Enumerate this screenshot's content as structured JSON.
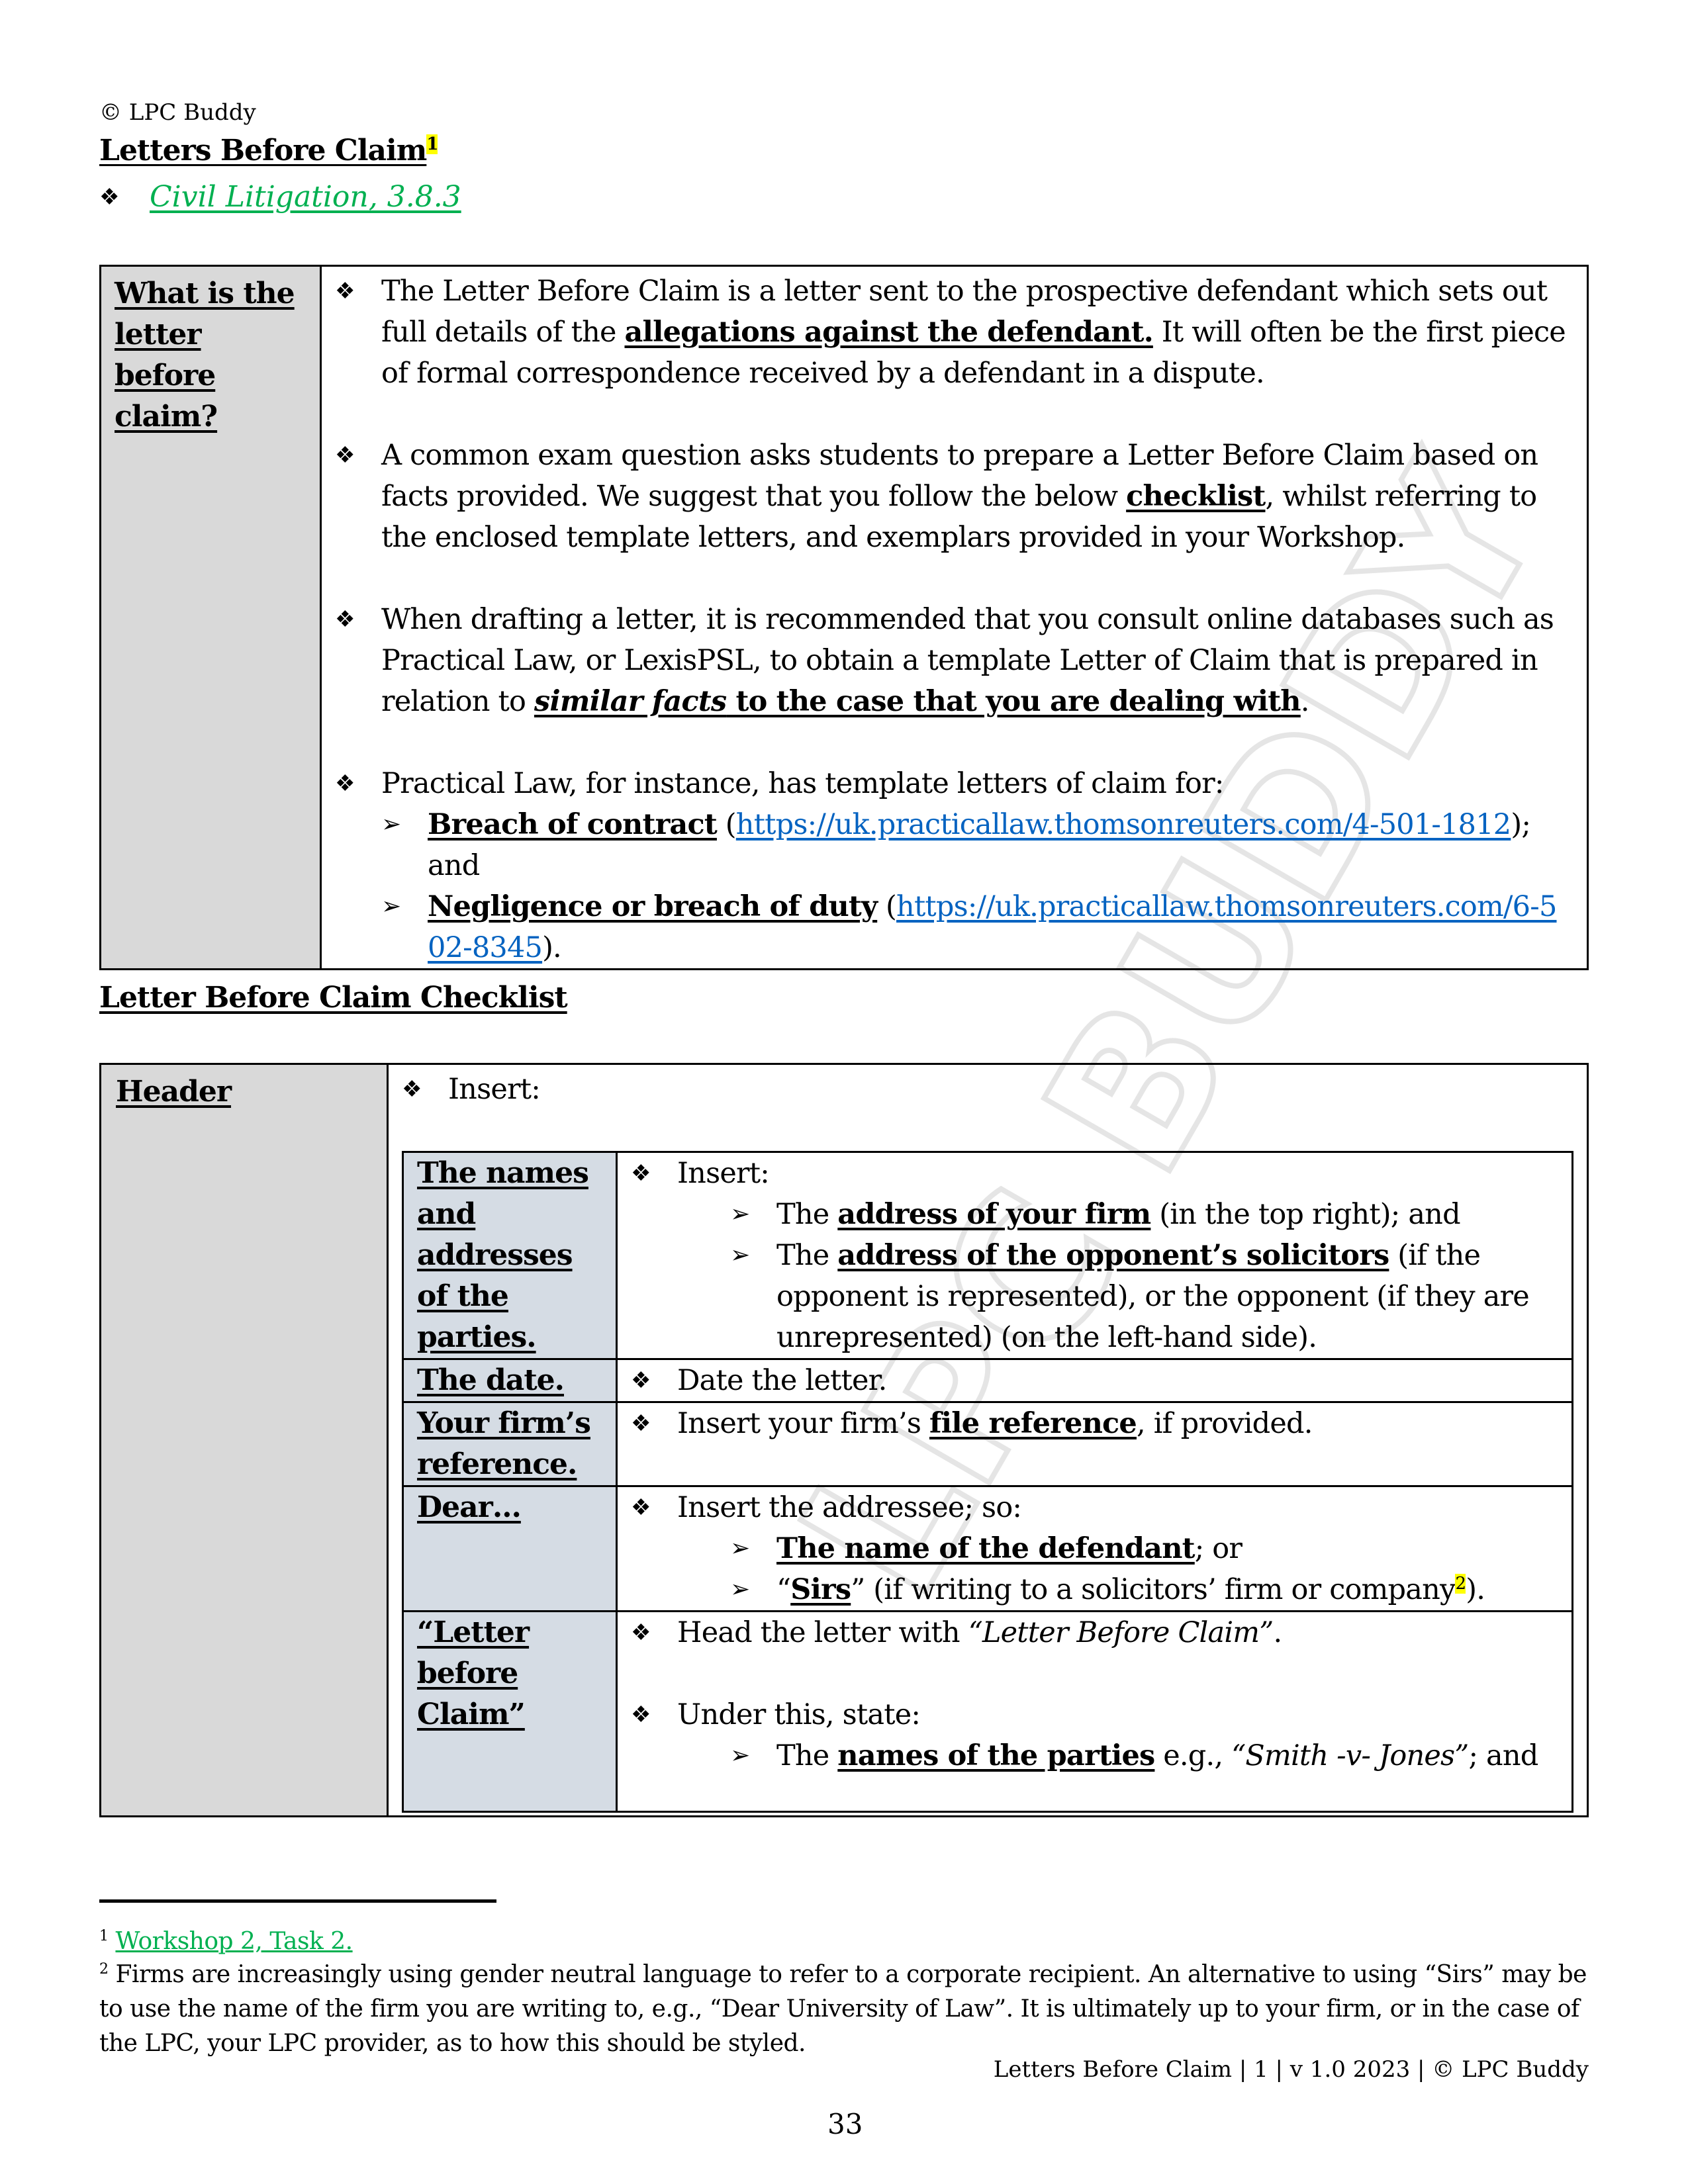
{
  "header": {
    "copyright": "© LPC Buddy",
    "title": "Letters Before Claim",
    "title_footnote_ref": "1",
    "reference_link": "Civil Litigation, 3.8.3"
  },
  "intro_table": {
    "label": "What is the letter before claim?",
    "bullets": [
      {
        "parts": [
          "The Letter Before Claim is a letter sent to the prospective defendant which sets out full details of the ",
          "allegations against the defendant.",
          " It will often be the first piece of formal correspondence received by a defendant in a dispute."
        ]
      },
      {
        "parts": [
          "A common exam question asks students to prepare a Letter Before Claim based on facts provided. We suggest that you follow the below ",
          "checklist",
          ", whilst referring to the enclosed template letters, and exemplars provided in your Workshop."
        ]
      },
      {
        "parts": [
          "When drafting a letter, it is recommended that you consult online databases such as Practical Law, or LexisPSL, to obtain a template Letter of Claim that is prepared in relation to ",
          "similar facts",
          " to the case that you are dealing with",
          "."
        ]
      },
      {
        "text": "Practical Law, for instance, has template letters of claim for:",
        "sub_items": [
          {
            "label": "Breach of contract",
            "open": " (",
            "url": "https://uk.practicallaw.thomsonreuters.com/4-501-1812",
            "close": "); and"
          },
          {
            "label": "Negligence or breach of duty",
            "open": " (",
            "url": "https://uk.practicallaw.thomsonreuters.com/6-502-8345",
            "close": ")."
          }
        ]
      }
    ]
  },
  "checklist": {
    "heading": "Letter Before Claim Checklist",
    "section_label": "Header",
    "section_intro": "Insert:",
    "rows": [
      {
        "label": "The names and addresses of the parties.",
        "bullet": "Insert:",
        "sub_items": [
          {
            "pre": "The ",
            "bold": "address of your firm",
            "post": " (in the top right); and"
          },
          {
            "pre": "The ",
            "bold": "address of the opponent’s solicitors",
            "post": " (if the opponent is represented), or the opponent (if they are unrepresented) (on the left-hand side)."
          }
        ]
      },
      {
        "label": "The date.",
        "bullet": "Date the letter."
      },
      {
        "label": "Your firm’s reference.",
        "bullet_pre": "Insert your firm’s ",
        "bullet_bold": "file reference",
        "bullet_post": ", if provided."
      },
      {
        "label": "Dear…",
        "bullet": "Insert the addressee; so:",
        "sub_items": [
          {
            "bold": "The name of the defendant",
            "post": "; or"
          },
          {
            "open_quote": "“",
            "bold": "Sirs",
            "post": "” (if writing to a solicitors’ firm or company",
            "footnote_ref": "2",
            "tail": ")."
          }
        ]
      },
      {
        "label": "“Letter before Claim”",
        "bullet1_pre": "Head the letter with ",
        "bullet1_italic": "“Letter Before Claim”",
        "bullet1_post": ".",
        "bullet2": "Under this, state:",
        "sub_items": [
          {
            "pre": "The ",
            "bold": "names of the parties",
            "mid": " e.g., ",
            "italic": "“Smith -v- Jones”",
            "post": "; and"
          }
        ]
      }
    ]
  },
  "footnotes": [
    {
      "num": "1",
      "text": "Workshop 2, Task 2."
    },
    {
      "num": "2",
      "text": "Firms are increasingly using gender neutral language to refer to a corporate recipient. An alternative to using “Sirs” may be to use the name of the firm you are writing to, e.g., “Dear University of Law”. It is ultimately up to your firm, or in the case of the LPC, your LPC provider, as to how this should be styled."
    }
  ],
  "footer": {
    "running": "Letters Before Claim | 1 | v 1.0 2023 | © LPC Buddy",
    "page_number": "33"
  },
  "watermark": "LPC BUDDY",
  "icons": {
    "bullet": "❖",
    "sub_bullet": "➢"
  },
  "colors": {
    "green_link": "#00b050",
    "blue_link": "#0563c1",
    "highlight": "#ffff00",
    "label_gray": "#d9d9d9",
    "label_blue_gray": "#d5dce4"
  }
}
